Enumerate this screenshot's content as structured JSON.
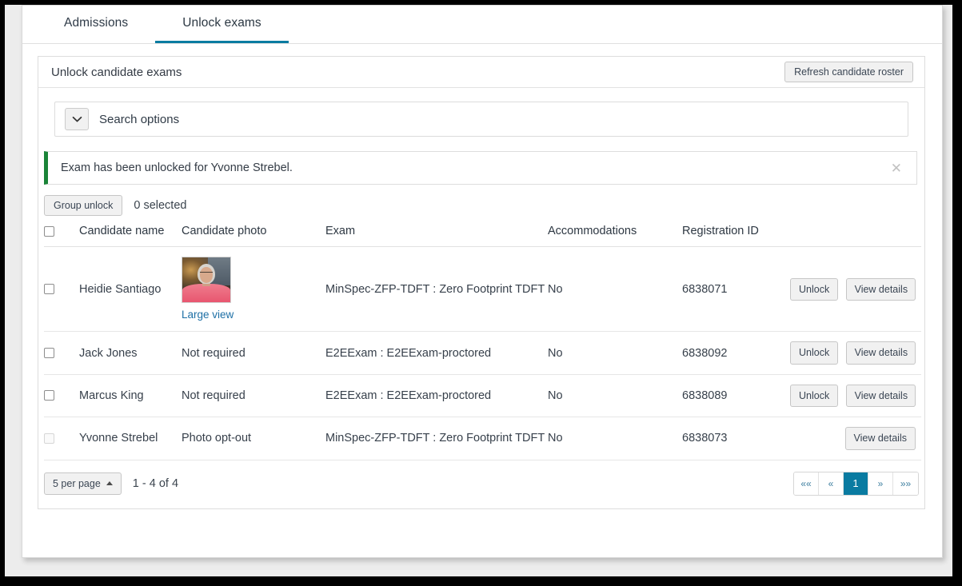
{
  "tabs": [
    {
      "label": "Admissions",
      "active": false
    },
    {
      "label": "Unlock exams",
      "active": true
    }
  ],
  "panel": {
    "title": "Unlock candidate exams",
    "refresh_label": "Refresh candidate roster"
  },
  "search": {
    "label": "Search options",
    "chevron_icon": "chevron-down-icon"
  },
  "alert": {
    "message": "Exam has been unlocked for Yvonne Strebel.",
    "close_icon": "close-icon",
    "accent_color": "#1a8438"
  },
  "toolbar": {
    "group_unlock_label": "Group unlock",
    "selected_text": "0 selected"
  },
  "table": {
    "headers": {
      "name": "Candidate name",
      "photo": "Candidate photo",
      "exam": "Exam",
      "accommodations": "Accommodations",
      "registration": "Registration ID"
    },
    "rows": [
      {
        "name": "Heidie Santiago",
        "photo_type": "image",
        "photo_text": "",
        "large_view_label": "Large view",
        "exam": "MinSpec-ZFP-TDFT : Zero Footprint TDFT",
        "accommodations": "No",
        "registration_id": "6838071",
        "unlock_label": "Unlock",
        "view_label": "View details",
        "has_unlock": true,
        "checkbox_disabled": false
      },
      {
        "name": "Jack Jones",
        "photo_type": "text",
        "photo_text": "Not required",
        "large_view_label": "",
        "exam": "E2EExam : E2EExam-proctored",
        "accommodations": "No",
        "registration_id": "6838092",
        "unlock_label": "Unlock",
        "view_label": "View details",
        "has_unlock": true,
        "checkbox_disabled": false
      },
      {
        "name": "Marcus King",
        "photo_type": "text",
        "photo_text": "Not required",
        "large_view_label": "",
        "exam": "E2EExam : E2EExam-proctored",
        "accommodations": "No",
        "registration_id": "6838089",
        "unlock_label": "Unlock",
        "view_label": "View details",
        "has_unlock": true,
        "checkbox_disabled": false
      },
      {
        "name": "Yvonne Strebel",
        "photo_type": "text",
        "photo_text": "Photo opt-out",
        "large_view_label": "",
        "exam": "MinSpec-ZFP-TDFT : Zero Footprint TDFT",
        "accommodations": "No",
        "registration_id": "6838073",
        "unlock_label": "",
        "view_label": "View details",
        "has_unlock": false,
        "checkbox_disabled": true
      }
    ]
  },
  "footer": {
    "per_page_label": "5 per page",
    "range_text": "1 - 4 of 4",
    "pagination": [
      {
        "label": "««",
        "name": "first",
        "active": false
      },
      {
        "label": "«",
        "name": "prev",
        "active": false
      },
      {
        "label": "1",
        "name": "page-1",
        "active": true
      },
      {
        "label": "»",
        "name": "next",
        "active": false
      },
      {
        "label": "»»",
        "name": "last",
        "active": false
      }
    ]
  },
  "theme": {
    "accent": "#0a7ba1",
    "success": "#1a8438",
    "link": "#1d6fa5"
  }
}
